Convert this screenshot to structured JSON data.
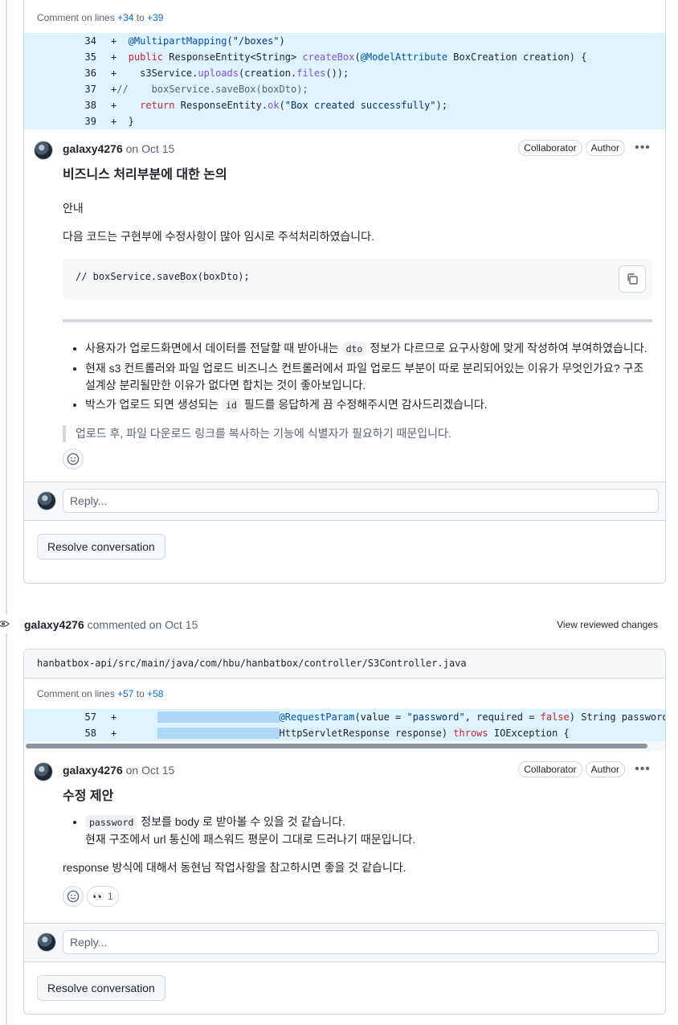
{
  "thread1": {
    "comment_on_prefix": "Comment on lines",
    "line_start": "+34",
    "line_to": "to",
    "line_end": "+39",
    "code_lines": [
      {
        "num": "34",
        "sign": "+",
        "html_key": "l34"
      },
      {
        "num": "35",
        "sign": "+",
        "html_key": "l35"
      },
      {
        "num": "36",
        "sign": "+",
        "html_key": "l36"
      },
      {
        "num": "37",
        "sign": "+",
        "html_key": "l37"
      },
      {
        "num": "38",
        "sign": "+",
        "html_key": "l38"
      },
      {
        "num": "39",
        "sign": "+",
        "html_key": "l39"
      }
    ],
    "code_text": {
      "l34": "  @MultipartMapping(\"/boxes\")",
      "l35": "  public ResponseEntity<String> createBox(@ModelAttribute BoxCreation creation) {",
      "l36": "    s3Service.uploads(creation.files());",
      "l37": "//    boxService.saveBox(boxDto);",
      "l38": "    return ResponseEntity.ok(\"Box created successfully\");",
      "l39": "  }"
    },
    "comment": {
      "author": "galaxy4276",
      "when": "on Oct 15",
      "badge_collaborator": "Collaborator",
      "badge_author": "Author",
      "title": "비즈니스 처리부분에 대한 논의",
      "notice": "안내",
      "intro": "다음 코드는 구현부에 수정사항이 많아 임시로 주석처리하였습니다.",
      "code_block": "//    boxService.saveBox(boxDto);",
      "bullet1_a": "사용자가 업로드화면에서 데이터를 전달할 때 받아내는",
      "bullet1_code": "dto",
      "bullet1_b": "정보가 다르므로 요구사항에 맞게 작성하여 부여하였습니다.",
      "bullet2": "현재 s3 컨트롤러와 파일 업로드 비즈니스 컨트롤러에서 파일 업로드 부분이 따로 분리되어있는 이유가 무엇인가요? 구조설계상 분리될만한 이유가 없다면 합치는 것이 좋아보입니다.",
      "bullet3_a": "박스가 업로드 되면 생성되는",
      "bullet3_code": "id",
      "bullet3_b": "필드를 응답하게 끔 수정해주시면 감사드리겠습니다.",
      "quote": "업로드 후, 파일 다운로드 링크를 복사하는 기능에 식별자가 필요하기 때문입니다."
    },
    "reply_placeholder": "Reply...",
    "resolve_label": "Resolve conversation"
  },
  "timeline_event": {
    "author": "galaxy4276",
    "action": "commented on Oct 15",
    "view_changes": "View reviewed changes"
  },
  "thread2": {
    "file_path": "hanbatbox-api/src/main/java/com/hbu/hanbatbox/controller/S3Controller.java",
    "comment_on_prefix": "Comment on lines",
    "line_start": "+57",
    "line_to": "to",
    "line_end": "+58",
    "code_lines": [
      {
        "num": "57",
        "sign": "+"
      },
      {
        "num": "58",
        "sign": "+"
      }
    ],
    "comment": {
      "author": "galaxy4276",
      "when": "on Oct 15",
      "badge_collaborator": "Collaborator",
      "badge_author": "Author",
      "title": "수정 제안",
      "bullet_code": "password",
      "bullet_a": "정보를 body 로 받아볼 수 있을 것 같습니다.",
      "bullet_b": "현재 구조에서 url 통신에 패스워드 평문이 그대로 드러나기 때문입니다.",
      "para": "response 방식에 대해서 동현님 작업사항을 참고하시면 좋을 것 같습니다.",
      "reaction_eyes": "👀",
      "reaction_count": "1"
    },
    "reply_placeholder": "Reply...",
    "resolve_label": "Resolve conversation"
  }
}
